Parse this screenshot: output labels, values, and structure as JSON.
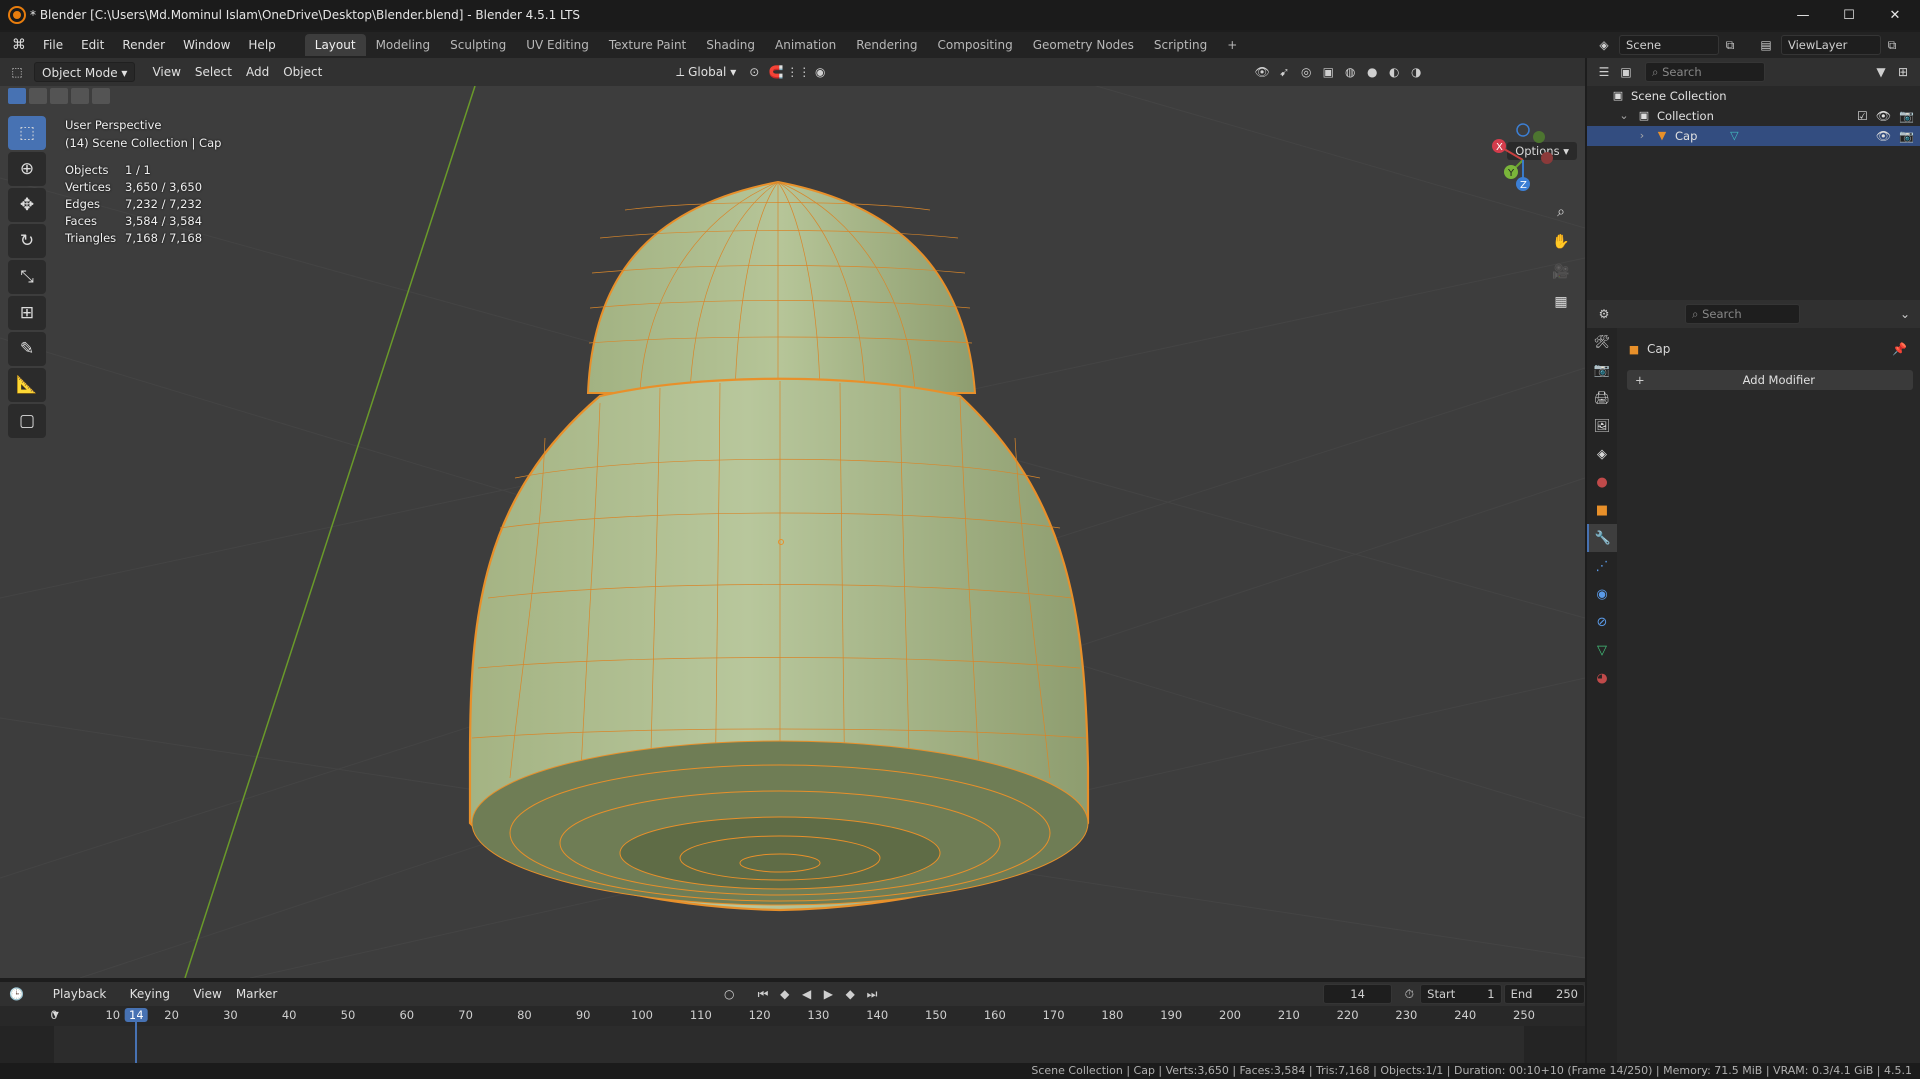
{
  "window": {
    "title": "* Blender [C:\\Users\\Md.Mominul Islam\\OneDrive\\Desktop\\Blender.blend] - Blender 4.5.1 LTS",
    "minimize": "—",
    "maximize": "☐",
    "close": "✕"
  },
  "menu": {
    "items": [
      "File",
      "Edit",
      "Render",
      "Window",
      "Help"
    ],
    "workspaces": [
      "Layout",
      "Modeling",
      "Sculpting",
      "UV Editing",
      "Texture Paint",
      "Shading",
      "Animation",
      "Rendering",
      "Compositing",
      "Geometry Nodes",
      "Scripting"
    ],
    "active_workspace": "Layout",
    "add_tab": "+",
    "scene": "Scene",
    "view_layer": "ViewLayer"
  },
  "viewport": {
    "mode": "Object Mode",
    "menus": [
      "View",
      "Select",
      "Add",
      "Object"
    ],
    "orientation": "Global",
    "options": "Options",
    "perspective": "User Perspective",
    "collection_info": "(14) Scene Collection | Cap",
    "stats": [
      {
        "label": "Objects",
        "value": "1 / 1"
      },
      {
        "label": "Vertices",
        "value": "3,650 / 3,650"
      },
      {
        "label": "Edges",
        "value": "7,232 / 7,232"
      },
      {
        "label": "Faces",
        "value": "3,584 / 3,584"
      },
      {
        "label": "Triangles",
        "value": "7,168 / 7,168"
      }
    ],
    "gizmo": {
      "x": "X",
      "y": "Y",
      "z": "Z"
    },
    "colors": {
      "background": "#3d3d3d",
      "mesh_fill": "#a8b88a",
      "wire": "#e8902a",
      "axis_green": "#6a9a2a",
      "axis_red": "#b03030"
    }
  },
  "outliner": {
    "search_placeholder": "Search",
    "items": [
      {
        "label": "Scene Collection"
      },
      {
        "label": "Collection"
      },
      {
        "label": "Cap"
      }
    ]
  },
  "properties": {
    "search_placeholder": "Search",
    "object_name": "Cap",
    "add_modifier": "Add Modifier"
  },
  "timeline": {
    "menus": [
      "Playback",
      "Keying",
      "View",
      "Marker"
    ],
    "current_frame": "14",
    "start_label": "Start",
    "start": "1",
    "end_label": "End",
    "end": "250",
    "ticks": [
      "0",
      "10",
      "14",
      "20",
      "30",
      "40",
      "50",
      "60",
      "70",
      "80",
      "90",
      "100",
      "110",
      "120",
      "130",
      "140",
      "150",
      "160",
      "170",
      "180",
      "190",
      "200",
      "210",
      "220",
      "230",
      "240",
      "250"
    ]
  },
  "statusbar": {
    "text": "Scene Collection | Cap | Verts:3,650 | Faces:3,584 | Tris:7,168 | Objects:1/1 | Duration: 00:10+10 (Frame 14/250) | Memory: 71.5 MiB | VRAM: 0.3/4.1 GiB | 4.5.1"
  }
}
